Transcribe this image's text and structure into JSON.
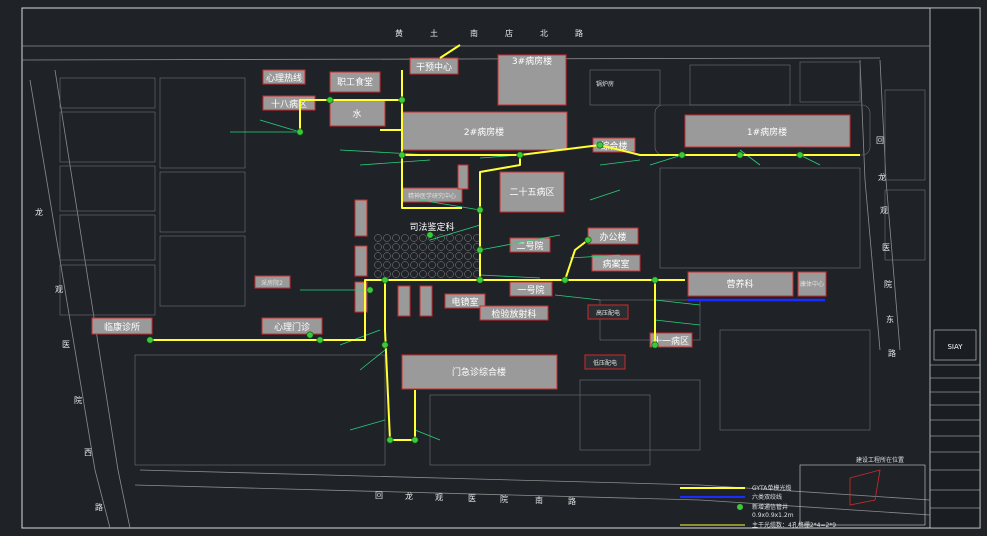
{
  "roads": {
    "north": [
      "黄",
      "土",
      "南",
      "店",
      "北",
      "路"
    ],
    "east": [
      "回",
      "龙",
      "观",
      "医",
      "院",
      "东",
      "路"
    ],
    "west": [
      "龙",
      "观",
      "医",
      "院",
      "西",
      "路"
    ],
    "south": [
      "回",
      "龙",
      "观",
      "医",
      "院",
      "南",
      "路"
    ]
  },
  "buildings": {
    "xinli_rehab": "心理热线",
    "ward18": "十八病区",
    "staff_canteen": "职工食堂",
    "water": "水",
    "intervention": "干预中心",
    "ward3": "3#病房楼",
    "boiler": "锅炉房",
    "ward2": "2#病房楼",
    "ward1": "1#病房楼",
    "general": "综合楼",
    "mental_research": "精神医学研究中心",
    "ward25": "二十五病区",
    "judicial": "司法鉴定科",
    "ward_2nd": "二号院",
    "office": "办公楼",
    "ward_room": "病案室",
    "nutrition": "营养科",
    "health_center": "康体中心",
    "ward_1st": "一号院",
    "ecg": "电镜室",
    "lab_radiology": "检验放射科",
    "hv_power": "高压配电",
    "ward11": "十一病区",
    "lv_power": "低压配电",
    "outpatient": "门急诊综合楼",
    "psych_clinic": "心理门诊",
    "clinic": "临康诊所",
    "ward_room2": "采房院2"
  },
  "legend": {
    "items": [
      "GYTA单模光缆",
      "六类双绞线",
      "新增通信管井",
      "0.9x0.9x1.2m",
      "主干光缆数：4孔格栅2*4=2*9"
    ]
  },
  "title_block": {
    "logo": "SIAY",
    "location_note": "建设工程所在位置"
  },
  "colors": {
    "background": "#1f2328",
    "fiber": "#ffff33",
    "cat6": "#1a2cff",
    "node": "#3cc83c",
    "branch": "#2ad07a",
    "building": "#9a9a9a",
    "outline": "#d02a2a"
  }
}
